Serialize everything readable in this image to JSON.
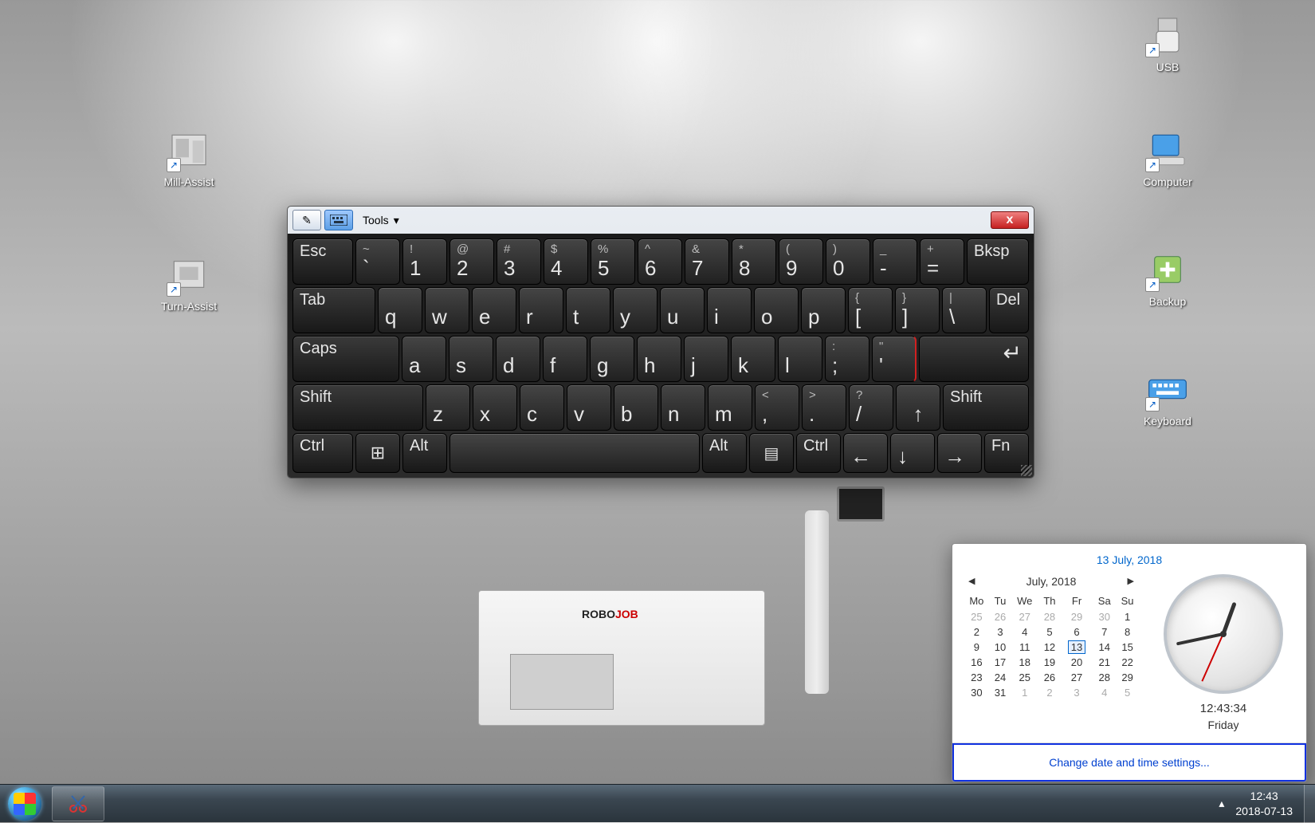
{
  "desktop_icons": {
    "mill_assist": "Mill-Assist",
    "turn_assist": "Turn-Assist",
    "usb": "USB",
    "computer": "Computer",
    "backup": "Backup",
    "keyboard": "Keyboard"
  },
  "osk": {
    "tools": "Tools",
    "close": "x",
    "row1": {
      "esc": "Esc",
      "k1": {
        "u": "~",
        "l": "`"
      },
      "k2": {
        "u": "!",
        "l": "1"
      },
      "k3": {
        "u": "@",
        "l": "2"
      },
      "k4": {
        "u": "#",
        "l": "3"
      },
      "k5": {
        "u": "$",
        "l": "4"
      },
      "k6": {
        "u": "%",
        "l": "5"
      },
      "k7": {
        "u": "^",
        "l": "6"
      },
      "k8": {
        "u": "&",
        "l": "7"
      },
      "k9": {
        "u": "*",
        "l": "8"
      },
      "k10": {
        "u": "(",
        "l": "9"
      },
      "k11": {
        "u": ")",
        "l": "0"
      },
      "k12": {
        "u": "_",
        "l": "-"
      },
      "k13": {
        "u": "+",
        "l": "="
      },
      "bksp": "Bksp"
    },
    "row2": {
      "tab": "Tab",
      "q": "q",
      "w": "w",
      "e": "e",
      "r": "r",
      "t": "t",
      "y": "y",
      "u": "u",
      "i": "i",
      "o": "o",
      "p": "p",
      "br1": {
        "u": "{",
        "l": "["
      },
      "br2": {
        "u": "}",
        "l": "]"
      },
      "bs": {
        "u": "|",
        "l": "\\"
      },
      "del": "Del"
    },
    "row3": {
      "caps": "Caps",
      "a": "a",
      "s": "s",
      "d": "d",
      "f": "f",
      "g": "g",
      "h": "h",
      "j": "j",
      "k": "k",
      "l": "l",
      "sc": {
        "u": ":",
        "l": ";"
      },
      "qu": {
        "u": "\"",
        "l": "'"
      },
      "enter": "↵"
    },
    "row4": {
      "shiftl": "Shift",
      "z": "z",
      "x": "x",
      "c": "c",
      "v": "v",
      "b": "b",
      "n": "n",
      "m": "m",
      "cm": {
        "u": "<",
        "l": ","
      },
      "pd": {
        "u": ">",
        "l": "."
      },
      "sl": {
        "u": "?",
        "l": "/"
      },
      "up": "↑",
      "shiftr": "Shift"
    },
    "row5": {
      "ctrll": "Ctrl",
      "win": "⊞",
      "altl": "Alt",
      "space": "",
      "altr": "Alt",
      "menu": "▤",
      "ctrlr": "Ctrl",
      "left": "←",
      "down": "↓",
      "right": "→",
      "fn": "Fn"
    }
  },
  "datetime": {
    "title": "13 July, 2018",
    "month": "July, 2018",
    "dow": [
      "Mo",
      "Tu",
      "We",
      "Th",
      "Fr",
      "Sa",
      "Su"
    ],
    "weeks": [
      [
        {
          "d": "25",
          "g": 1
        },
        {
          "d": "26",
          "g": 1
        },
        {
          "d": "27",
          "g": 1
        },
        {
          "d": "28",
          "g": 1
        },
        {
          "d": "29",
          "g": 1
        },
        {
          "d": "30",
          "g": 1
        },
        {
          "d": "1"
        }
      ],
      [
        {
          "d": "2"
        },
        {
          "d": "3"
        },
        {
          "d": "4"
        },
        {
          "d": "5"
        },
        {
          "d": "6"
        },
        {
          "d": "7"
        },
        {
          "d": "8"
        }
      ],
      [
        {
          "d": "9"
        },
        {
          "d": "10"
        },
        {
          "d": "11"
        },
        {
          "d": "12"
        },
        {
          "d": "13",
          "t": 1
        },
        {
          "d": "14"
        },
        {
          "d": "15"
        }
      ],
      [
        {
          "d": "16"
        },
        {
          "d": "17"
        },
        {
          "d": "18"
        },
        {
          "d": "19"
        },
        {
          "d": "20"
        },
        {
          "d": "21"
        },
        {
          "d": "22"
        }
      ],
      [
        {
          "d": "23"
        },
        {
          "d": "24"
        },
        {
          "d": "25"
        },
        {
          "d": "26"
        },
        {
          "d": "27"
        },
        {
          "d": "28"
        },
        {
          "d": "29"
        }
      ],
      [
        {
          "d": "30"
        },
        {
          "d": "31"
        },
        {
          "d": "1",
          "g": 1
        },
        {
          "d": "2",
          "g": 1
        },
        {
          "d": "3",
          "g": 1
        },
        {
          "d": "4",
          "g": 1
        },
        {
          "d": "5",
          "g": 1
        }
      ]
    ],
    "time": "12:43:34",
    "day": "Friday",
    "link": "Change date and time settings..."
  },
  "taskbar": {
    "clock_time": "12:43",
    "clock_date": "2018-07-13"
  },
  "wallpaper": {
    "brand1": "ROBO",
    "brand2": "JOB"
  }
}
